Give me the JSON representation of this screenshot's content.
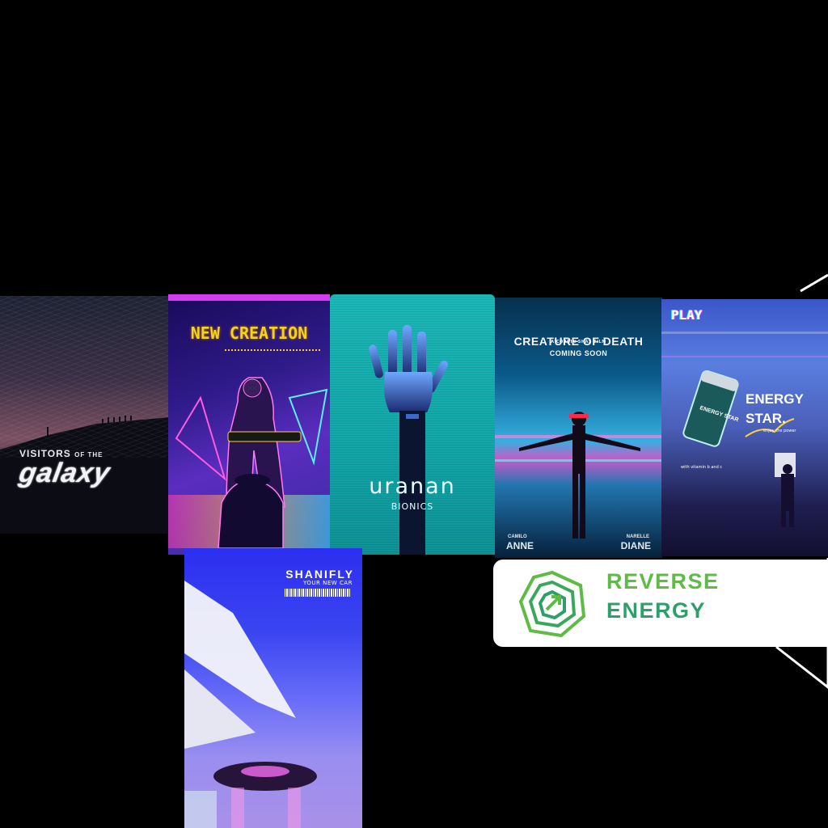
{
  "posters": {
    "galaxy": {
      "title_pre": "VISITORS",
      "title_mid": "OF THE",
      "title_main": "galaxy"
    },
    "creation": {
      "title": "NEW CREATION",
      "accent_color": "#d43cf0",
      "title_color": "#f5d21b"
    },
    "uranan": {
      "title": "uranan",
      "subtitle": "BIONICS"
    },
    "creature": {
      "byline": "A CORBIN SHAS FILM",
      "title": "CREATURE OF DEATH",
      "subtitle": "COMING SOON",
      "cast": [
        {
          "first": "CAMILO",
          "last": "ANNE"
        },
        {
          "first": "NARELLE",
          "last": "DIANE"
        }
      ]
    },
    "energy": {
      "play": "PLAY",
      "title_line1": "ENERGY",
      "title_line2": "STAR.",
      "tagline": "enjoy the power",
      "vitamins": "with vitamin b and c",
      "can_label": "ENERGY STAR"
    },
    "shanifly": {
      "title": "SHANIFLY",
      "subtitle": "YOUR NEW CAR"
    }
  },
  "logo_card": {
    "line1": "REVERSE",
    "line2": "ENERGY",
    "colors": {
      "line1": "#5dbb46",
      "line2": "#2e9f6a"
    }
  }
}
